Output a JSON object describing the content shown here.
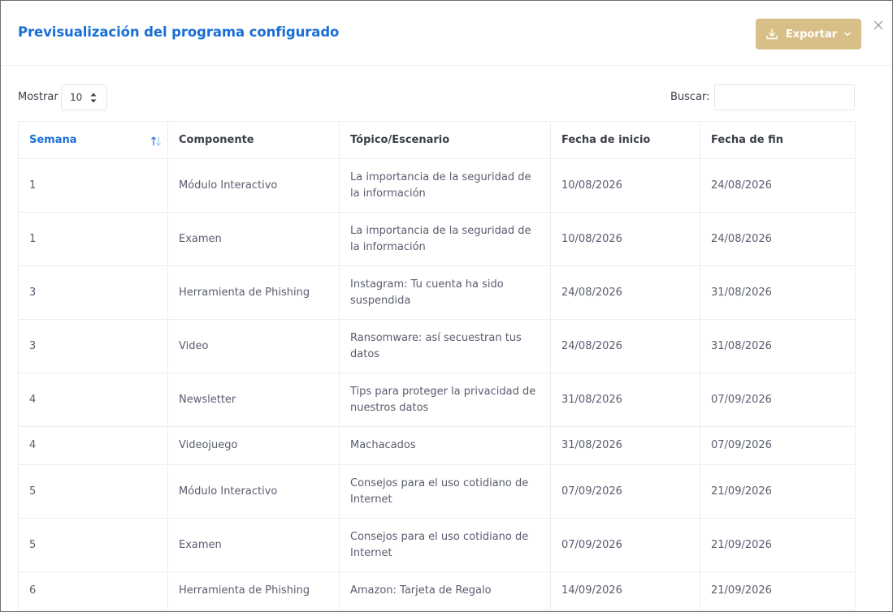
{
  "modal": {
    "title": "Previsualización del programa configurado",
    "export_label": "Exportar",
    "close_glyph": "×"
  },
  "controls": {
    "show_label": "Mostrar",
    "page_length": "10",
    "search_label": "Buscar:",
    "search_value": ""
  },
  "colors": {
    "title": "#1a6fd6",
    "export_bg": "#d8bf88",
    "border": "#ebedf2"
  },
  "table": {
    "headers": [
      "Semana",
      "Componente",
      "Tópico/Escenario",
      "Fecha de inicio",
      "Fecha de fin"
    ],
    "sorted_column": "Semana",
    "rows": [
      {
        "semana": "1",
        "componente": "Módulo Interactivo",
        "topico": "La importancia de la seguridad de la información",
        "inicio": "10/08/2026",
        "fin": "24/08/2026"
      },
      {
        "semana": "1",
        "componente": "Examen",
        "topico": "La importancia de la seguridad de la información",
        "inicio": "10/08/2026",
        "fin": "24/08/2026"
      },
      {
        "semana": "3",
        "componente": "Herramienta de Phishing",
        "topico": "Instagram: Tu cuenta ha sido suspendida",
        "inicio": "24/08/2026",
        "fin": "31/08/2026"
      },
      {
        "semana": "3",
        "componente": "Video",
        "topico": "Ransomware: así secuestran tus datos",
        "inicio": "24/08/2026",
        "fin": "31/08/2026"
      },
      {
        "semana": "4",
        "componente": "Newsletter",
        "topico": "Tips para proteger la privacidad de nuestros datos",
        "inicio": "31/08/2026",
        "fin": "07/09/2026"
      },
      {
        "semana": "4",
        "componente": "Videojuego",
        "topico": "Machacados",
        "inicio": "31/08/2026",
        "fin": "07/09/2026"
      },
      {
        "semana": "5",
        "componente": "Módulo Interactivo",
        "topico": "Consejos para el uso cotidiano de Internet",
        "inicio": "07/09/2026",
        "fin": "21/09/2026"
      },
      {
        "semana": "5",
        "componente": "Examen",
        "topico": "Consejos para el uso cotidiano de Internet",
        "inicio": "07/09/2026",
        "fin": "21/09/2026"
      },
      {
        "semana": "6",
        "componente": "Herramienta de Phishing",
        "topico": "Amazon: Tarjeta de Regalo",
        "inicio": "14/09/2026",
        "fin": "21/09/2026"
      }
    ]
  }
}
